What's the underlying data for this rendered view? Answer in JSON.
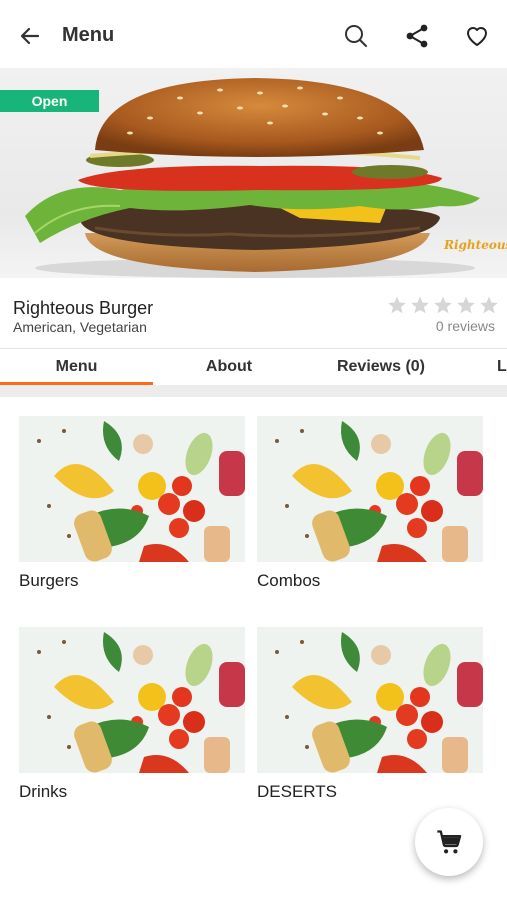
{
  "appbar": {
    "title": "Menu",
    "icons": [
      "back-arrow-icon",
      "search-icon",
      "share-icon",
      "heart-icon"
    ]
  },
  "hero": {
    "badge": "Open",
    "brand_mark": "Righteous"
  },
  "restaurant": {
    "name": "Righteous Burger",
    "cuisine": "American, Vegetarian",
    "rating": 0,
    "rating_max": 5,
    "reviews_label": "0 reviews"
  },
  "tabs": [
    {
      "label": "Menu",
      "active": true
    },
    {
      "label": "About",
      "active": false
    },
    {
      "label": "Reviews (0)",
      "active": false
    },
    {
      "label": "L",
      "active": false
    }
  ],
  "categories": [
    {
      "label": "Burgers"
    },
    {
      "label": "Combos"
    },
    {
      "label": "Drinks"
    },
    {
      "label": "DESERTS"
    }
  ],
  "colors": {
    "accent": "#ff6a1a",
    "open_badge": "#17b57a",
    "star_empty": "#d6d6d6"
  },
  "fab": {
    "icon": "cart-icon"
  }
}
